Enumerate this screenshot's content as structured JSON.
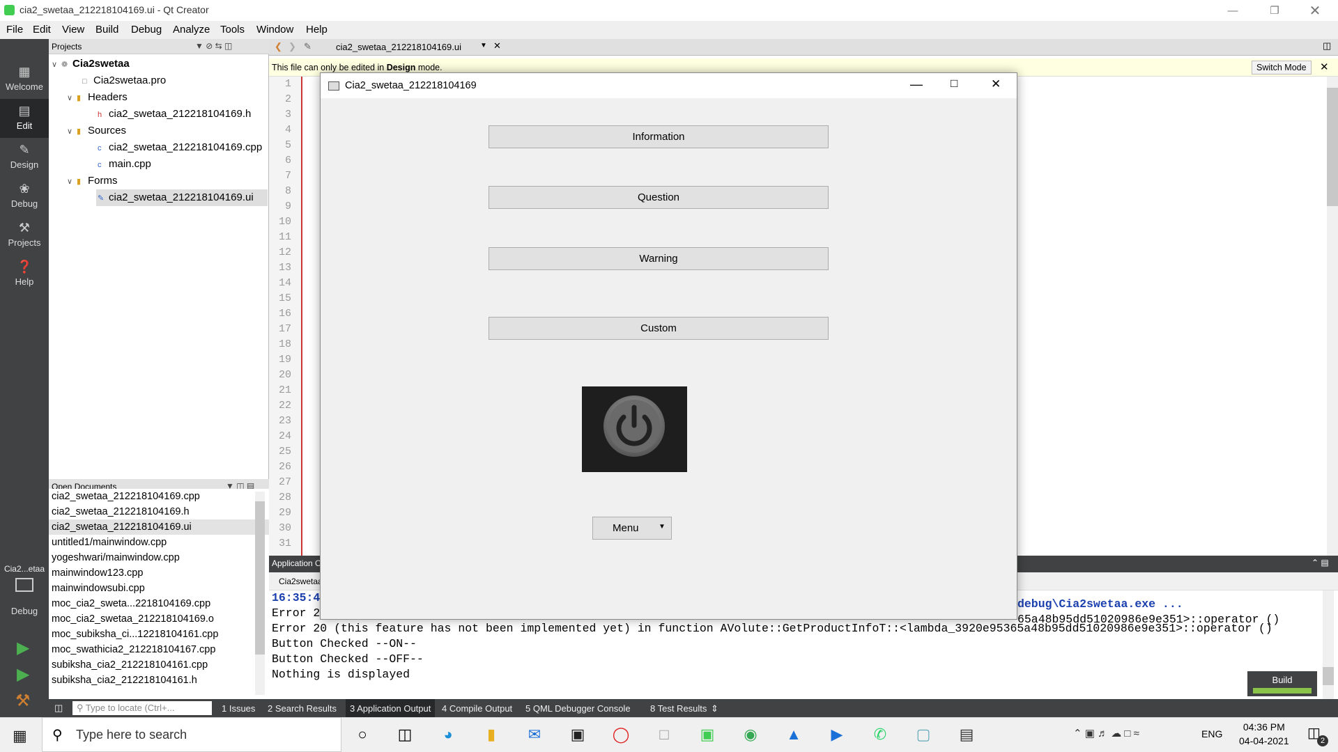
{
  "window": {
    "title": "cia2_swetaa_212218104169.ui - Qt Creator"
  },
  "menu": [
    "File",
    "Edit",
    "View",
    "Build",
    "Debug",
    "Analyze",
    "Tools",
    "Window",
    "Help"
  ],
  "modes": [
    {
      "label": "Welcome",
      "icon": "grid-icon"
    },
    {
      "label": "Edit",
      "icon": "edit-icon"
    },
    {
      "label": "Design",
      "icon": "pencil-icon"
    },
    {
      "label": "Debug",
      "icon": "bug-icon"
    },
    {
      "label": "Projects",
      "icon": "wrench-icon"
    },
    {
      "label": "Help",
      "icon": "help-icon"
    }
  ],
  "project_panel": {
    "title": "Projects",
    "root": "Cia2swetaa",
    "pro": "Cia2swetaa.pro",
    "headers_label": "Headers",
    "header_file": "cia2_swetaa_212218104169.h",
    "sources_label": "Sources",
    "source_files": [
      "cia2_swetaa_212218104169.cpp",
      "main.cpp"
    ],
    "forms_label": "Forms",
    "form_file": "cia2_swetaa_212218104169.ui"
  },
  "open_documents": {
    "title": "Open Documents",
    "items": [
      "cia2_swetaa_212218104169.cpp",
      "cia2_swetaa_212218104169.h",
      "cia2_swetaa_212218104169.ui",
      "untitled1/mainwindow.cpp",
      "yogeshwari/mainwindow.cpp",
      "mainwindow123.cpp",
      "mainwindowsubi.cpp",
      "moc_cia2_sweta...2218104169.cpp",
      "moc_cia2_swetaa_212218104169.o",
      "moc_subiksha_ci...12218104161.cpp",
      "moc_swathicia2_212218104167.cpp",
      "subiksha_cia2_212218104161.cpp",
      "subiksha_cia2_212218104161.h"
    ],
    "selected_index": 2
  },
  "kit": {
    "label": "Cia2...etaa",
    "mode": "Debug"
  },
  "editor": {
    "tab": "cia2_swetaa_212218104169.ui",
    "info_pre": "This file can only be edited in ",
    "info_bold": "Design",
    "info_post": " mode.",
    "switch_mode": "Switch Mode",
    "line_numbers": [
      "1",
      "2",
      "3",
      "4",
      "5",
      "6",
      "7",
      "8",
      "9",
      "10",
      "11",
      "12",
      "13",
      "14",
      "15",
      "16",
      "17",
      "18",
      "19",
      "20",
      "21",
      "22",
      "23",
      "24",
      "25",
      "26",
      "27",
      "28",
      "29",
      "30",
      "31"
    ]
  },
  "app_window": {
    "title": "Cia2_swetaa_212218104169",
    "buttons": [
      "Information",
      "Question",
      "Warning",
      "Custom"
    ],
    "menu_button": "Menu"
  },
  "output": {
    "header": "Application Output",
    "tab": "Cia2swetaa",
    "line1_time": "16:35:4",
    "line1_tail": "debug\\Cia2swetaa.exe ...",
    "line2_start": "Error 2",
    "line2_tail": "65a48b95dd51020986e9e351>::operator ()",
    "line3": "Error 20 (this feature has not been implemented yet) in function AVolute::GetProductInfoT::<lambda_3920e95365a48b95dd51020986e9e351>::operator ()",
    "line4": "Button Checked --ON--",
    "line5": "Button Checked --OFF--",
    "line6": "Nothing is displayed",
    "build_label": "Build"
  },
  "status_bar": {
    "locate_placeholder": "Type to locate (Ctrl+...",
    "tabs": [
      "1  Issues",
      "2  Search Results",
      "3  Application Output",
      "4  Compile Output",
      "5  QML Debugger Console",
      "8  Test Results"
    ]
  },
  "taskbar": {
    "search_placeholder": "Type here to search",
    "time": "04:36 PM",
    "date": "04-04-2021",
    "lang": "ENG",
    "notif_count": "2"
  }
}
